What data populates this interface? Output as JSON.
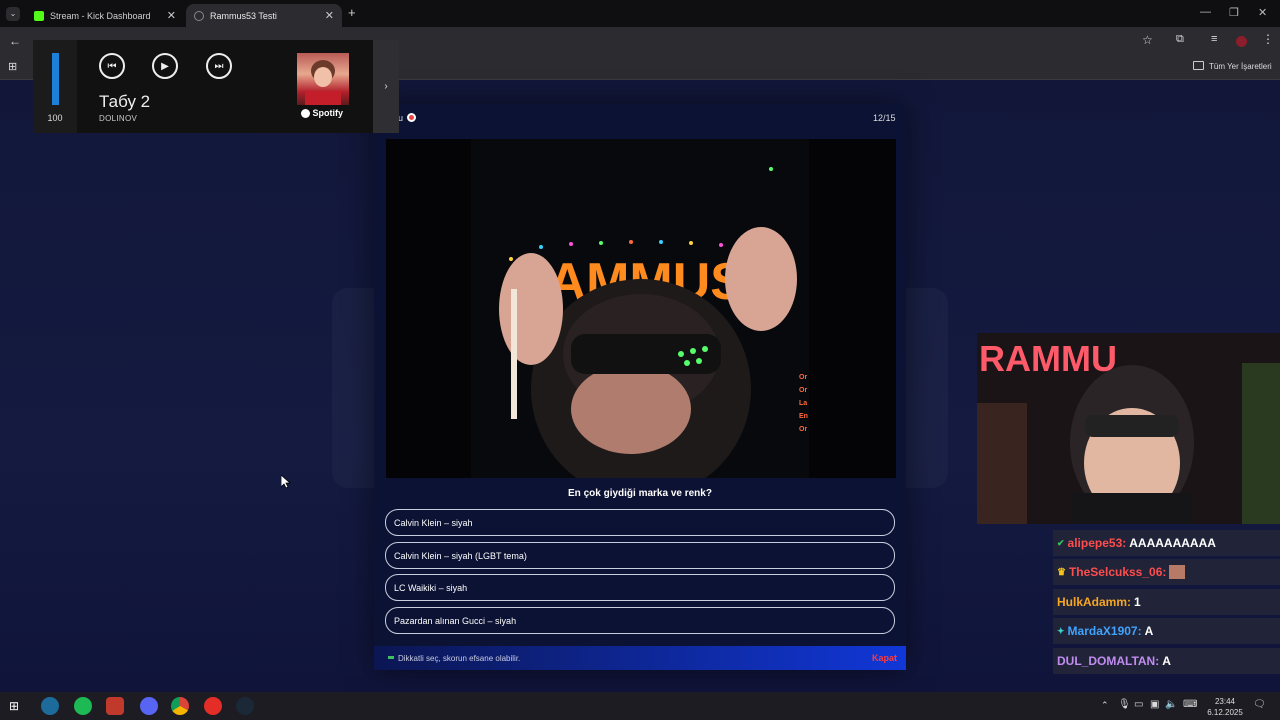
{
  "browser": {
    "tabs": [
      {
        "title": "Stream - Kick Dashboard"
      },
      {
        "title": "Rammus53 Testi"
      }
    ],
    "bookmarks_label": "Tüm Yer İşaretleri"
  },
  "media": {
    "volume": "100",
    "volume_level": 1.0,
    "song_title": "Табу 2",
    "song_artist": "DOLINOV",
    "source": "Spotify"
  },
  "quiz": {
    "header_left": "u",
    "counter": "12/15",
    "question": "En çok giydiği marka ve renk?",
    "options": [
      "Calvin Klein – siyah",
      "Calvin Klein – siyah (LGBT tema)",
      "LC Waikiki – siyah",
      "Pazardan alınan Gucci – siyah"
    ],
    "footer_hint": "Dikkatli seç, skorun efsane olabilir.",
    "close_label": "Kapat"
  },
  "video": {
    "sign_text": "RAMMUS",
    "side_text": [
      "Or",
      "Or",
      "La",
      "En",
      "Or"
    ]
  },
  "webcam": {
    "sign_text": "RAMMU"
  },
  "chat": [
    {
      "user": "alipepe53:",
      "message": "AAAAAAAAAA",
      "color": "#ff4d4d"
    },
    {
      "user": "TheSelcukss_06:",
      "message": "",
      "color": "#ff4d4d"
    },
    {
      "user": "HulkAdamm:",
      "message": "1",
      "color": "#f5a623"
    },
    {
      "user": "MardaX1907:",
      "message": "A",
      "color": "#3fa3ff"
    },
    {
      "user": "DUL_DOMALTAN:",
      "message": "A",
      "color": "#c08cf0"
    }
  ],
  "taskbar": {
    "time": "23:44",
    "date": "6.12.2025"
  }
}
